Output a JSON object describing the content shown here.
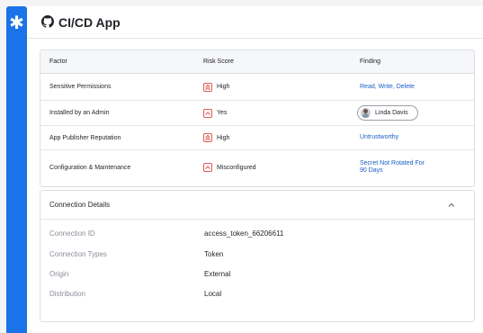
{
  "app": {
    "title": "CI/CD App"
  },
  "icons": {
    "sidebar_logo": "asterisk-logo-icon",
    "app_icon": "github-icon",
    "collapse": "chevron-up-icon"
  },
  "colors": {
    "accent": "#1a73e8",
    "risk": "#e05a57",
    "link": "#1a5fc7"
  },
  "risk_table": {
    "headers": {
      "factor": "Factor",
      "score": "Risk Score",
      "finding": "Finding"
    },
    "rows": [
      {
        "factor": "Sensitive Permissions",
        "score": "High",
        "score_icon": "double-chevron-up-icon",
        "finding": "Read, Write, Delete"
      },
      {
        "factor": "Installed by an Admin",
        "score": "Yes",
        "score_icon": "chevron-up-icon",
        "finding": "Linda Davis"
      },
      {
        "factor": "App Publisher Reputation",
        "score": "High",
        "score_icon": "double-chevron-up-icon",
        "finding": "Untrustworthy"
      },
      {
        "factor": "Configuration & Maintenance",
        "score": "Misconfigured",
        "score_icon": "chevron-up-icon",
        "finding_line1": "Secret Not Rotated For",
        "finding_line2": "90 Days"
      }
    ]
  },
  "connection": {
    "title": "Connection Details",
    "fields": [
      {
        "label": "Connection ID",
        "value": "access_token_66206611"
      },
      {
        "label": "Connection Types",
        "value": "Token"
      },
      {
        "label": "Origin",
        "value": "External"
      },
      {
        "label": "Distribution",
        "value": "Local"
      }
    ]
  }
}
